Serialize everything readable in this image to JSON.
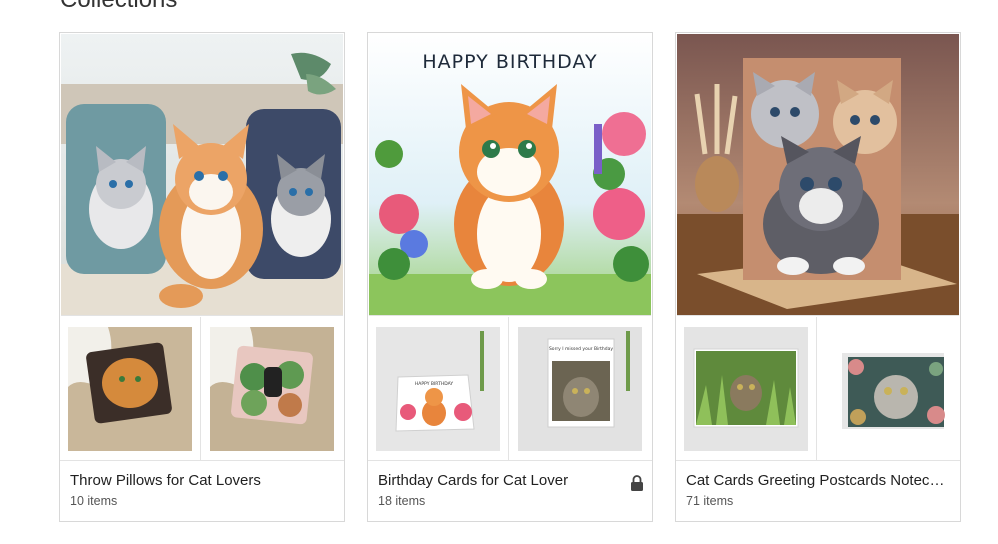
{
  "page": {
    "section_title": "Collections"
  },
  "collections": [
    {
      "title": "Throw Pillows for Cat Lovers",
      "count": "10 items",
      "locked": false,
      "hero_icon": "cats-on-pillows-image",
      "thumbs": [
        "pillow-image",
        "pillow-image"
      ]
    },
    {
      "title": "Birthday Cards for Cat Lover",
      "count": "18 items",
      "locked": true,
      "hero_text": "HAPPY BIRTHDAY",
      "hero_icon": "birthday-cat-image",
      "thumbs": [
        "card-image",
        "card-image"
      ],
      "thumb2_text": "Sorry I missed your Birthday",
      "thumb1_text": "HAPPY BIRTHDAY"
    },
    {
      "title": "Cat Cards Greeting Postcards Notecar...",
      "count": "71 items",
      "locked": false,
      "hero_icon": "kittens-card-image",
      "thumbs": [
        "postcard-image",
        "notecard-image"
      ]
    }
  ],
  "colors": {
    "border": "#d8d8d8",
    "text": "#212121",
    "muted": "#555555"
  }
}
